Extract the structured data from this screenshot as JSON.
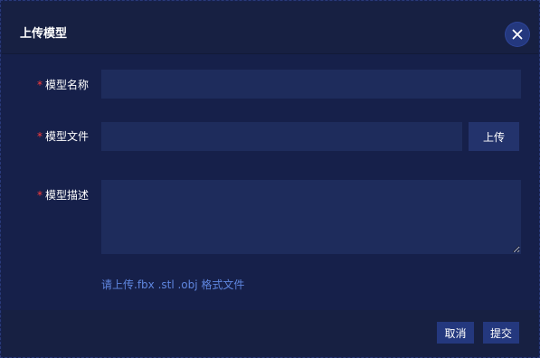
{
  "dialog": {
    "title": "上传模型",
    "close_icon": "close-icon"
  },
  "form": {
    "name": {
      "required_mark": "*",
      "label": "模型名称",
      "value": "",
      "placeholder": ""
    },
    "file": {
      "required_mark": "*",
      "label": "模型文件",
      "value": "",
      "placeholder": "",
      "upload_label": "上传"
    },
    "description": {
      "required_mark": "*",
      "label": "模型描述",
      "value": "",
      "placeholder": ""
    },
    "hint": "请上传.fbx .stl .obj 格式文件"
  },
  "footer": {
    "cancel_label": "取消",
    "submit_label": "提交"
  },
  "colors": {
    "background": "#16204a",
    "input": "#1e2c5c",
    "accent": "#24387e",
    "hint": "#5f86df",
    "required": "#ff3b3b"
  }
}
